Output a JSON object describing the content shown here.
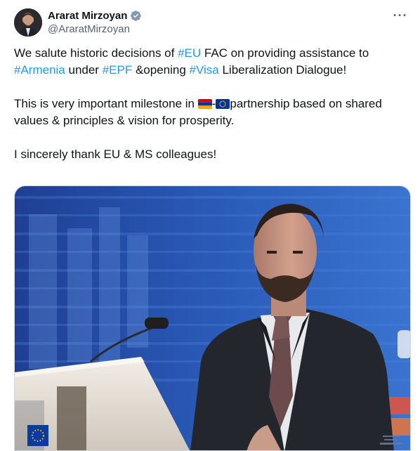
{
  "author": {
    "display_name": "Ararat Mirzoyan",
    "handle": "@AraratMirzoyan",
    "verified_icon": "verified-badge-icon"
  },
  "more_icon": "more-options-icon",
  "tweet": {
    "p1": {
      "t1": "We salute historic decisions of ",
      "tag1": "#EU",
      "t2": " FAC on providing assistance to ",
      "tag2": "#Armenia",
      "t3": " under ",
      "tag3": "#EPF",
      "t4": " &opening ",
      "tag4": "#Visa",
      "t5": " Liberalization Dialogue!"
    },
    "p2": {
      "t1": "This is very important milestone in ",
      "sep": "-",
      "t2": "partnership based on shared values & principles & vision for prosperity."
    },
    "p3": "I sincerely thank EU & MS colleagues!"
  },
  "media": {
    "icon": "photo-image"
  },
  "colors": {
    "link": "#1d9bf0",
    "text": "#0f1419",
    "secondary": "#536471",
    "armenia_flag": [
      "#d90012",
      "#0033a0",
      "#f2a800"
    ],
    "eu_flag": [
      "#003399",
      "#ffcc00"
    ]
  }
}
